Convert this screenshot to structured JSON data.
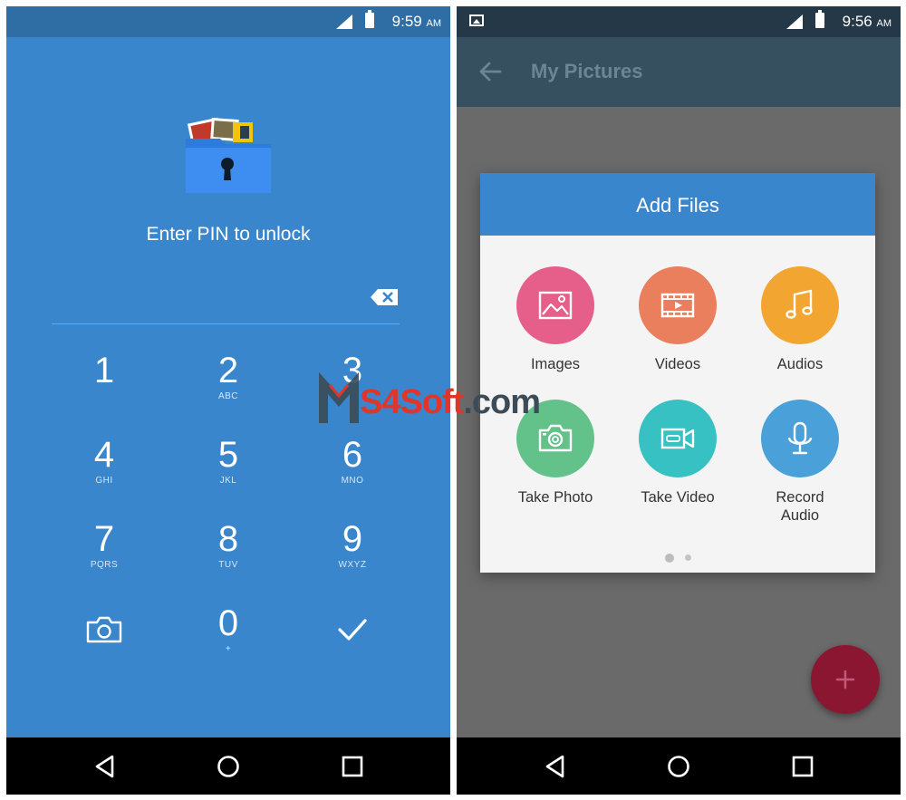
{
  "left_screen": {
    "status": {
      "time": "9:59",
      "ampm": "AM"
    },
    "prompt": "Enter PIN to unlock",
    "keypad": [
      {
        "digit": "1",
        "letters": ""
      },
      {
        "digit": "2",
        "letters": "ABC"
      },
      {
        "digit": "3",
        "letters": ""
      },
      {
        "digit": "4",
        "letters": "GHI"
      },
      {
        "digit": "5",
        "letters": "JKL"
      },
      {
        "digit": "6",
        "letters": "MNO"
      },
      {
        "digit": "7",
        "letters": "PQRS"
      },
      {
        "digit": "8",
        "letters": "TUV"
      },
      {
        "digit": "9",
        "letters": "WXYZ"
      },
      {
        "digit": "0",
        "letters": "+"
      }
    ],
    "icons": {
      "camera": "camera-icon",
      "confirm": "checkmark-icon",
      "backspace": "backspace-icon",
      "illustration": "locked-folder-icon"
    }
  },
  "right_screen": {
    "status": {
      "time": "9:56",
      "ampm": "AM"
    },
    "toolbar": {
      "title": "My Pictures"
    },
    "dialog": {
      "title": "Add Files",
      "tiles": [
        {
          "label": "Images",
          "color": "#e55f8a",
          "icon": "image-icon"
        },
        {
          "label": "Videos",
          "color": "#ea7f5e",
          "icon": "film-icon"
        },
        {
          "label": "Audios",
          "color": "#f2a531",
          "icon": "music-note-icon"
        },
        {
          "label": "Take Photo",
          "color": "#63c18a",
          "icon": "camera-icon"
        },
        {
          "label": "Take Video",
          "color": "#38c1c3",
          "icon": "video-camera-icon"
        },
        {
          "label": "Record Audio",
          "color": "#4aa0d8",
          "icon": "microphone-icon"
        }
      ]
    },
    "fab": {
      "color": "#8b1632",
      "icon": "plus-icon"
    }
  },
  "watermark": {
    "prefix": "S4Soft",
    "suffix": ".com"
  },
  "colors": {
    "lock_background": "#3a86cc",
    "toolbar": "#37505f",
    "dialog_header": "#3a86cc"
  }
}
